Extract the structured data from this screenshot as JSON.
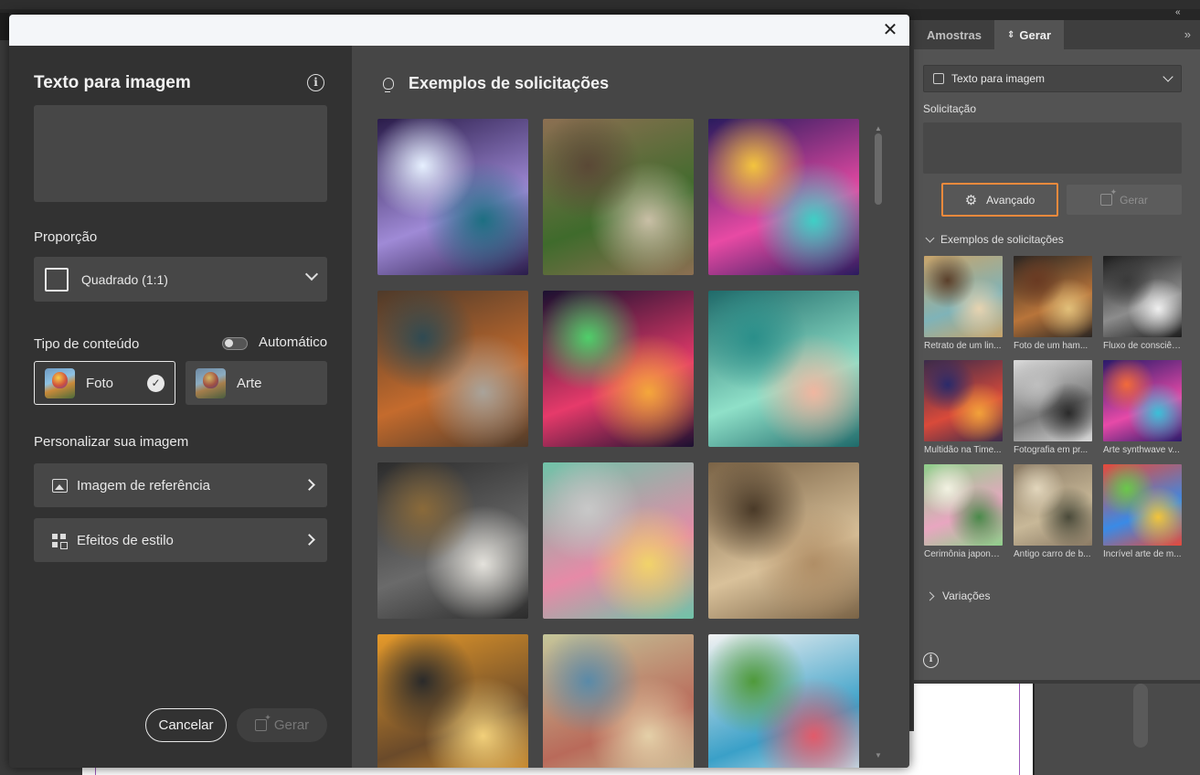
{
  "dialog": {
    "title": "Texto para imagem",
    "aspect_label": "Proporção",
    "aspect_value": "Quadrado (1:1)",
    "content_type_label": "Tipo de conteúdo",
    "auto_label": "Automático",
    "content_types": [
      {
        "label": "Foto",
        "selected": true
      },
      {
        "label": "Arte",
        "selected": false
      }
    ],
    "personalize_label": "Personalizar sua imagem",
    "reference_image_label": "Imagem de referência",
    "style_effects_label": "Efeitos de estilo",
    "cancel_label": "Cancelar",
    "generate_label": "Gerar",
    "examples_title": "Exemplos de solicitações",
    "example_tiles": [
      {
        "icon": "waterfall-image",
        "colors": [
          "#2a1c4a",
          "#9f8ad6",
          "#1d6f82",
          "#e6f0ff"
        ]
      },
      {
        "icon": "tropical-room-image",
        "colors": [
          "#8c6f52",
          "#3f6b2c",
          "#c9bfa6",
          "#5a4836"
        ]
      },
      {
        "icon": "dog-sunglasses-image",
        "colors": [
          "#2a1b5e",
          "#e84aa4",
          "#3ed0c6",
          "#f3c43e"
        ]
      },
      {
        "icon": "koala-camera-image",
        "colors": [
          "#4e3a2a",
          "#c46b2d",
          "#a9a39a",
          "#2f4a52"
        ]
      },
      {
        "icon": "neon-fruits-image",
        "colors": [
          "#1b1030",
          "#e63a6a",
          "#f4a73b",
          "#4fcf6a"
        ]
      },
      {
        "icon": "jellyfish-image",
        "colors": [
          "#1f6a6a",
          "#8fe0c8",
          "#f0b6a0",
          "#2a8f8a"
        ]
      },
      {
        "icon": "marble-still-life-image",
        "colors": [
          "#2c2c2c",
          "#6a6a6a",
          "#e4e2dc",
          "#8a6a3a"
        ]
      },
      {
        "icon": "laptop-desk-image",
        "colors": [
          "#6fc3a8",
          "#e68aa7",
          "#f1d36a",
          "#c8c8c8"
        ]
      },
      {
        "icon": "woman-portrait-image",
        "colors": [
          "#7a6346",
          "#d9c19a",
          "#b08e66",
          "#4a3a28"
        ]
      },
      {
        "icon": "giraffe-sunglasses-image",
        "colors": [
          "#e69a2a",
          "#6a4a2a",
          "#f2d07a",
          "#2a2a2a"
        ]
      },
      {
        "icon": "desert-trailer-image",
        "colors": [
          "#c5c69a",
          "#b96a5a",
          "#e4d0a8",
          "#5a8aa8"
        ]
      },
      {
        "icon": "palm-street-image",
        "colors": [
          "#f2f2f2",
          "#3aa0c8",
          "#e25a6a",
          "#4f9a3a"
        ]
      }
    ]
  },
  "panel": {
    "tabs": [
      "Amostras",
      "Gerar"
    ],
    "active_tab": "Gerar",
    "mode_value": "Texto para imagem",
    "prompt_label": "Solicitação",
    "advanced_label": "Avançado",
    "generate_label": "Gerar",
    "examples_label": "Exemplos de solicitações",
    "variations_label": "Variações",
    "examples": [
      {
        "caption": "Retrato de um lin...",
        "colors": [
          "#c9a46a",
          "#7fb3b8",
          "#e7d3b0",
          "#5a3f2a"
        ]
      },
      {
        "caption": "Foto de um ham...",
        "colors": [
          "#2a2522",
          "#b8743a",
          "#e2c07a",
          "#6a3a22"
        ]
      },
      {
        "caption": "Fluxo de consciên...",
        "colors": [
          "#1c1c1c",
          "#8c8c8c",
          "#f0f0f0",
          "#3a3a3a"
        ]
      },
      {
        "caption": "Multidão na Time...",
        "colors": [
          "#3a2a4a",
          "#d94a3a",
          "#f2a23a",
          "#2a2a6a"
        ]
      },
      {
        "caption": "Fotografia em pr...",
        "colors": [
          "#dadada",
          "#7a7a7a",
          "#2a2a2a",
          "#bfbfbf"
        ]
      },
      {
        "caption": "Arte synthwave v...",
        "colors": [
          "#2a1a6a",
          "#e64aa8",
          "#3ac0d8",
          "#f26a3a"
        ]
      },
      {
        "caption": "Cerimônia japone...",
        "colors": [
          "#8ecf8a",
          "#e8a6c0",
          "#4a8a4a",
          "#f2f2e2"
        ]
      },
      {
        "caption": "Antigo carro de b...",
        "colors": [
          "#8a7a64",
          "#c8b898",
          "#4a4a3a",
          "#e2d6bc"
        ]
      },
      {
        "caption": "Incrível arte de m...",
        "colors": [
          "#e64a3a",
          "#3a8ae6",
          "#f2c43a",
          "#6ac84a"
        ]
      }
    ]
  }
}
